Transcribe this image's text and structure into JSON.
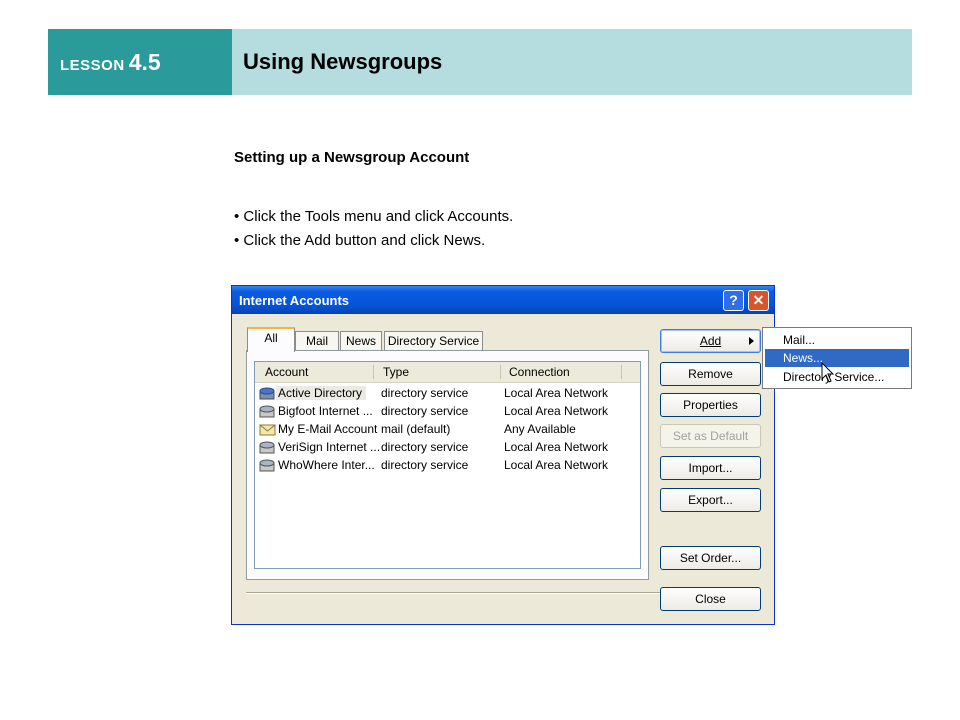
{
  "header": {
    "lesson_word": "LESSON",
    "lesson_number": "4.5",
    "title": "Using Newsgroups",
    "colors": {
      "lesson_bg": "#2b9a9a",
      "title_bg": "#b5dde0"
    }
  },
  "content": {
    "subheading": "Setting up a Newsgroup Account",
    "bullets": [
      "• Click the Tools menu and click Accounts.",
      "• Click the Add button and click News."
    ]
  },
  "dialog": {
    "title": "Internet Accounts",
    "help_icon": "?",
    "close_icon": "✕",
    "tabs": [
      "All",
      "Mail",
      "News",
      "Directory Service"
    ],
    "active_tab": "All",
    "columns": [
      "Account",
      "Type",
      "Connection"
    ],
    "rows": [
      {
        "account": "Active Directory",
        "type": "directory service",
        "connection": "Local Area Network",
        "icon": "directory-icon"
      },
      {
        "account": "Bigfoot Internet ...",
        "type": "directory service",
        "connection": "Local Area Network",
        "icon": "directory-icon"
      },
      {
        "account": "My E-Mail Account",
        "type": "mail (default)",
        "connection": "Any Available",
        "icon": "mail-icon"
      },
      {
        "account": "VeriSign Internet ...",
        "type": "directory service",
        "connection": "Local Area Network",
        "icon": "directory-icon"
      },
      {
        "account": "WhoWhere Inter...",
        "type": "directory service",
        "connection": "Local Area Network",
        "icon": "directory-icon"
      }
    ],
    "buttons": {
      "add": "Add",
      "remove": "Remove",
      "properties": "Properties",
      "set_default": "Set as Default",
      "import": "Import...",
      "export": "Export...",
      "set_order": "Set Order...",
      "close": "Close"
    }
  },
  "add_menu": {
    "items": [
      "Mail...",
      "News...",
      "Directory Service..."
    ],
    "highlighted": "News..."
  }
}
